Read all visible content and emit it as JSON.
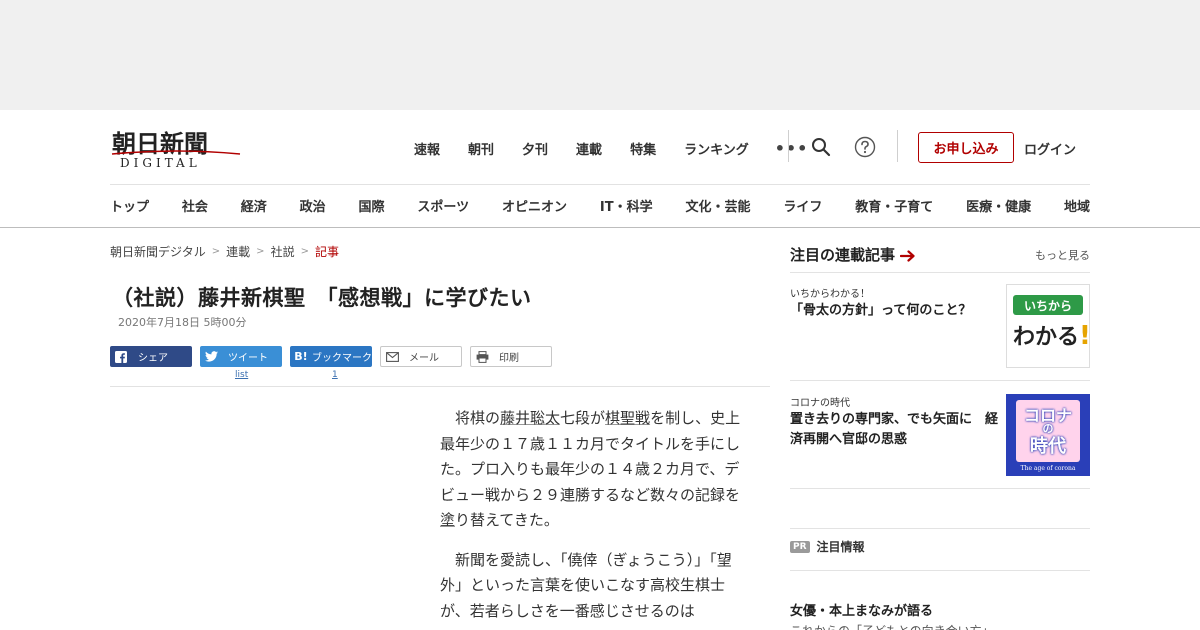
{
  "logo": {
    "title": "朝日新聞",
    "subtitle": "DIGITAL"
  },
  "top_nav": [
    "速報",
    "朝刊",
    "夕刊",
    "連載",
    "特集",
    "ランキング"
  ],
  "more_label": "•••",
  "header_actions": {
    "subscribe": "お申し込み",
    "login": "ログイン"
  },
  "categories": [
    "トップ",
    "社会",
    "経済",
    "政治",
    "国際",
    "スポーツ",
    "オピニオン",
    "IT・科学",
    "文化・芸能",
    "ライフ",
    "教育・子育て",
    "医療・健康",
    "地域"
  ],
  "breadcrumb": [
    "朝日新聞デジタル",
    "連載",
    "社説",
    "記事"
  ],
  "article": {
    "headline": "（社説）藤井新棋聖　「感想戦」に学びたい",
    "date": "2020年7月18日 5時00分",
    "share": {
      "facebook": "シェア",
      "twitter": "ツイート",
      "hatena": "ブックマーク",
      "mail": "メール",
      "print": "印刷",
      "twitter_count": "list",
      "hatena_count": "1"
    },
    "p1": {
      "a": "将棋の",
      "link1": "藤井聡太",
      "b": "七段が",
      "link2": "棋聖戦",
      "c": "を制し、史上最年少の１７歳１１カ月でタイトルを手にした。プロ入りも最年少の１４歳２カ月で、デビュー戦から２９連勝するなど数々の記録を",
      "link3": "塗",
      "d": "り替えてきた。"
    },
    "p2": "新聞を愛読し、「僥倖（ぎょうこう）」「望外」といった言葉を使いこなす高校生棋士が、若者らしさを一番感じさせるのは"
  },
  "sidebar": {
    "heading": "注目の連載記事",
    "more": "もっと見る",
    "items": [
      {
        "kicker": "いちからわかる！",
        "title": "「骨太の方針」って何のこと？",
        "thumb_line1": "いちから",
        "thumb_line2": "わかる",
        "thumb_mark": "!"
      },
      {
        "kicker": "コロナの時代",
        "title": "置き去りの専門家、でも矢面に　経済再開へ官邸の思惑",
        "thumb_line1": "コロナ",
        "thumb_line2": "の",
        "thumb_line3": "時代",
        "thumb_caption": "The age of corona"
      }
    ],
    "pr_badge": "PR",
    "pr_label": "注目情報",
    "promo_title": "女優・本上まなみが語る",
    "promo_sub": "これからの「子どもとの向き合い方」"
  },
  "colors": {
    "brand_red": "#b10000",
    "facebook": "#2f4a87",
    "twitter": "#3a8fd6",
    "hatena": "#2b76c3",
    "thumb_green": "#2e9a47",
    "thumb_blue": "#2a3fb8"
  }
}
